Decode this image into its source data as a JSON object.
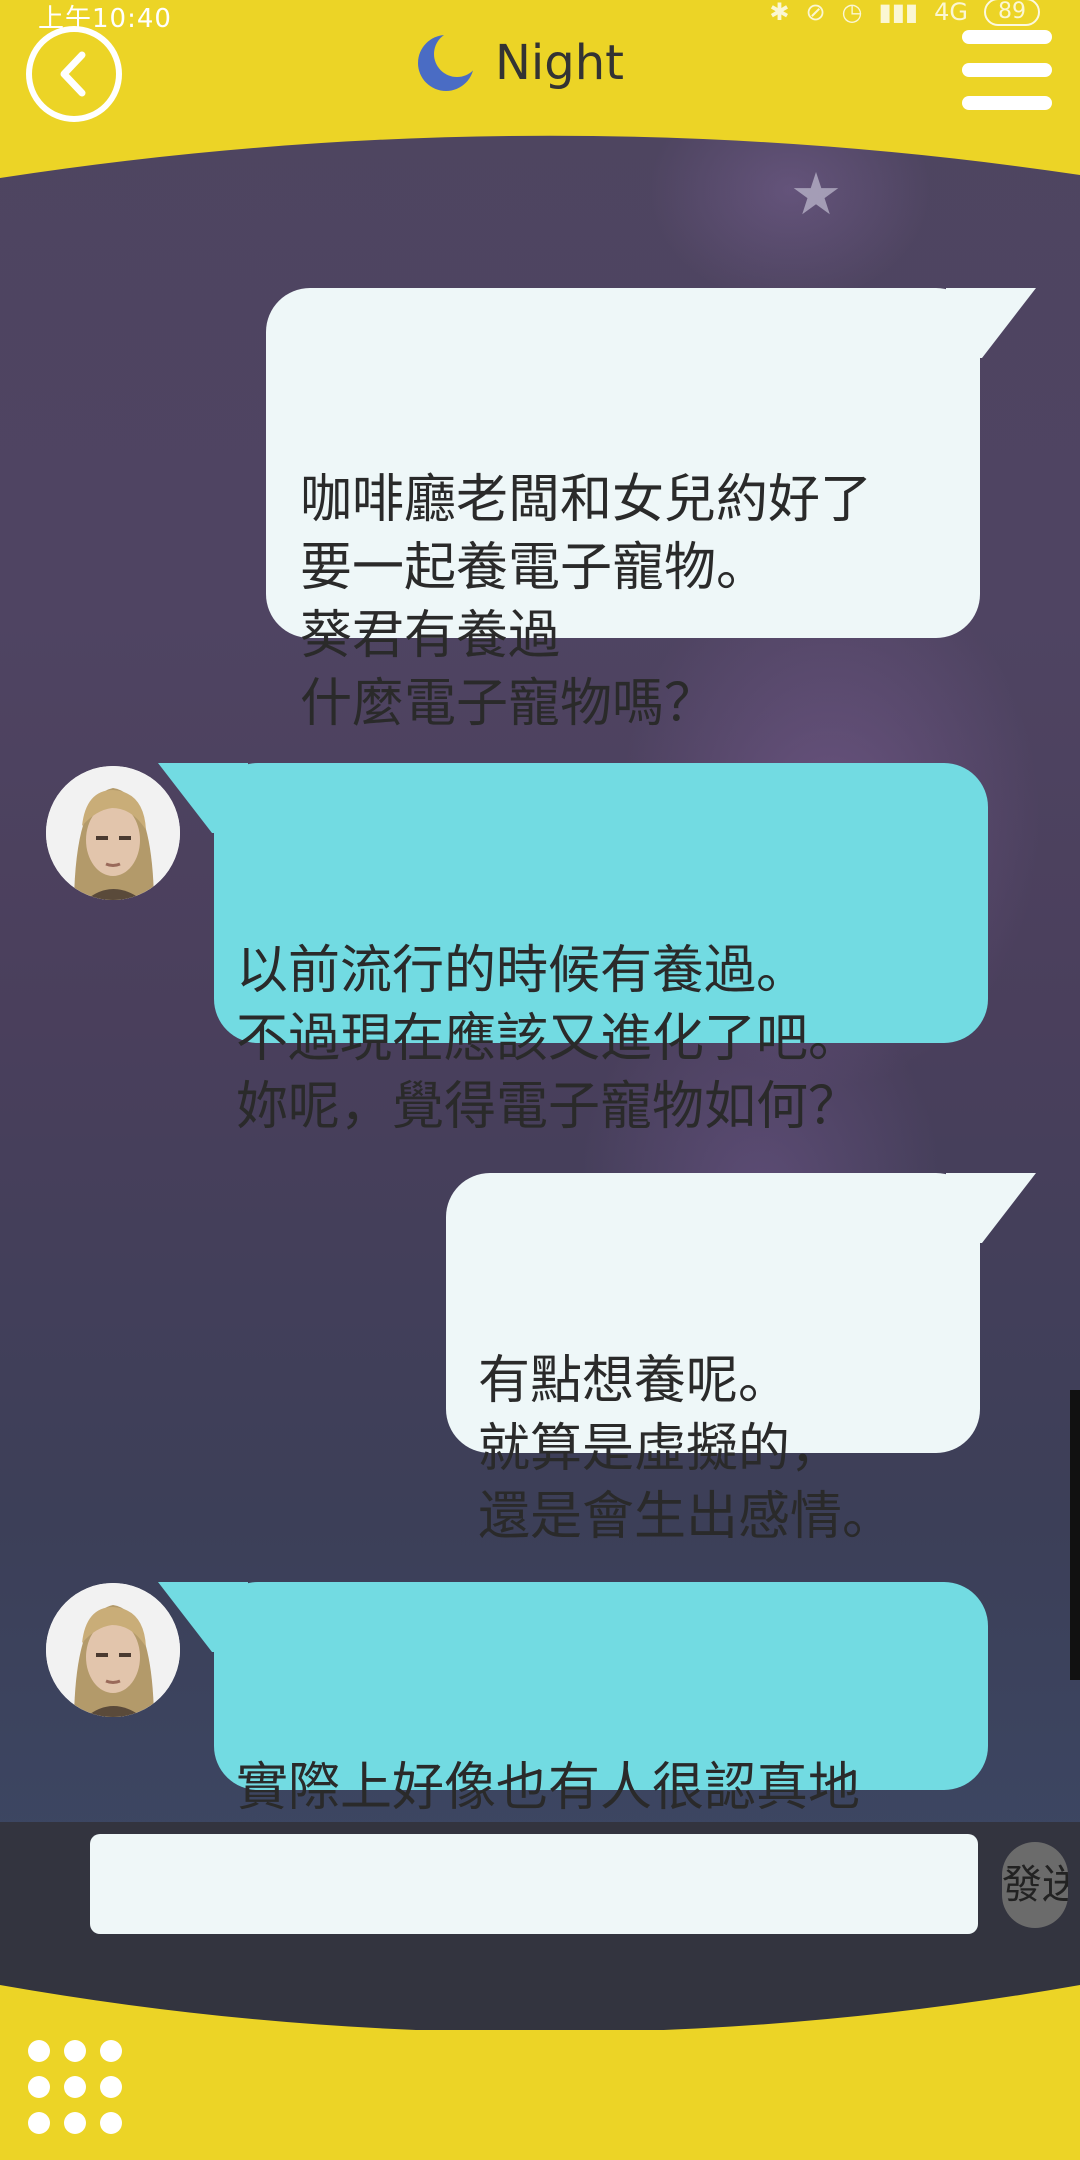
{
  "status_bar": {
    "time": "上午10:40",
    "network": "4G",
    "battery": "89"
  },
  "header": {
    "title": "Night",
    "back_icon": "back-arrow-icon",
    "moon_icon": "crescent-moon-icon",
    "menu_icon": "hamburger-menu-icon"
  },
  "messages": [
    {
      "sender": "me",
      "text": "咖啡廳老闆和女兒約好了\n要一起養電子寵物。\n葵君有養過\n什麼電子寵物嗎？"
    },
    {
      "sender": "them",
      "text": "以前流行的時候有養過。\n不過現在應該又進化了吧。\n妳呢，覺得電子寵物如何？"
    },
    {
      "sender": "me",
      "text": "有點想養呢。\n就算是虛擬的，\n還是會生出感情。"
    },
    {
      "sender": "them",
      "text": "實際上好像也有人很認真地\n放入感情照顧。"
    }
  ],
  "composer": {
    "input_value": "",
    "send_label": "發送"
  },
  "footer": {
    "grid_icon": "grid-menu-icon"
  },
  "colors": {
    "accent_yellow": "#ecd426",
    "my_bubble": "#eef7f8",
    "their_bubble": "#72dbe2"
  }
}
